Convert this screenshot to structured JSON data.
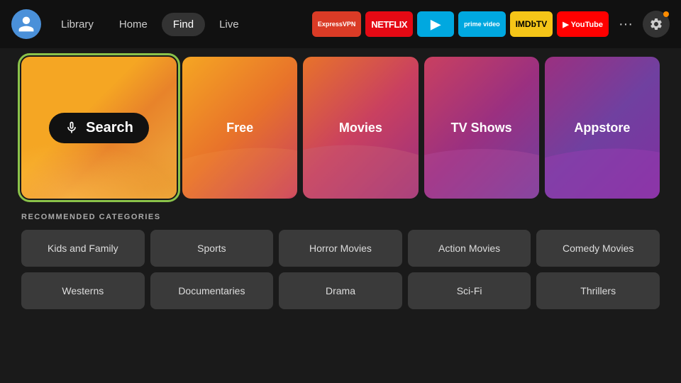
{
  "navbar": {
    "nav_items": [
      {
        "label": "Library",
        "active": false
      },
      {
        "label": "Home",
        "active": false
      },
      {
        "label": "Find",
        "active": true
      },
      {
        "label": "Live",
        "active": false
      }
    ],
    "apps": [
      {
        "label": "ExpressVPN",
        "class": "expressvpn"
      },
      {
        "label": "NETFLIX",
        "class": "netflix"
      },
      {
        "label": "▶",
        "class": "freevee"
      },
      {
        "label": "prime video",
        "class": "prime"
      },
      {
        "label": "IMDbTV",
        "class": "imdb"
      },
      {
        "label": "▶ YouTube",
        "class": "youtube"
      }
    ],
    "more_label": "···",
    "settings_label": "⚙"
  },
  "feature_tiles": [
    {
      "id": "search",
      "label": "Search"
    },
    {
      "id": "free",
      "label": "Free"
    },
    {
      "id": "movies",
      "label": "Movies"
    },
    {
      "id": "tvshows",
      "label": "TV Shows"
    },
    {
      "id": "appstore",
      "label": "Appstore"
    }
  ],
  "recommended": {
    "section_title": "RECOMMENDED CATEGORIES",
    "categories": [
      "Kids and Family",
      "Sports",
      "Horror Movies",
      "Action Movies",
      "Comedy Movies",
      "Westerns",
      "Documentaries",
      "Drama",
      "Sci-Fi",
      "Thrillers"
    ]
  }
}
